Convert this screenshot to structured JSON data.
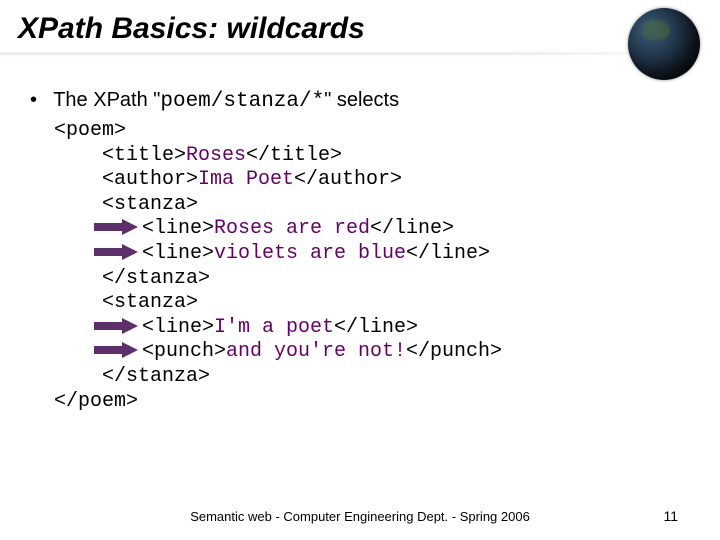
{
  "title": "XPath Basics: wildcards",
  "bullet": {
    "prefix": "The XPath \"",
    "xpath": "poem/stanza/*",
    "suffix": "\" selects"
  },
  "xml": {
    "l0": "<poem>",
    "l1a": "<title>",
    "l1b": "Roses",
    "l1c": "</title>",
    "l2a": "<author>",
    "l2b": "Ima Poet",
    "l2c": "</author>",
    "l3": "<stanza>",
    "l4a": "<line>",
    "l4b": "Roses are red",
    "l4c": "</line>",
    "l5a": "<line>",
    "l5b": "violets are blue",
    "l5c": "</line>",
    "l6": "</stanza>",
    "l7": "<stanza>",
    "l8a": "<line>",
    "l8b": "I'm a poet",
    "l8c": "</line>",
    "l9a": "<punch>",
    "l9b": "and you're not!",
    "l9c": "</punch>",
    "l10": "</stanza>",
    "l11": "</poem>"
  },
  "arrow_color": "#5d2f6b",
  "footer": "Semantic web - Computer Engineering Dept. - Spring 2006",
  "page_number": "11"
}
